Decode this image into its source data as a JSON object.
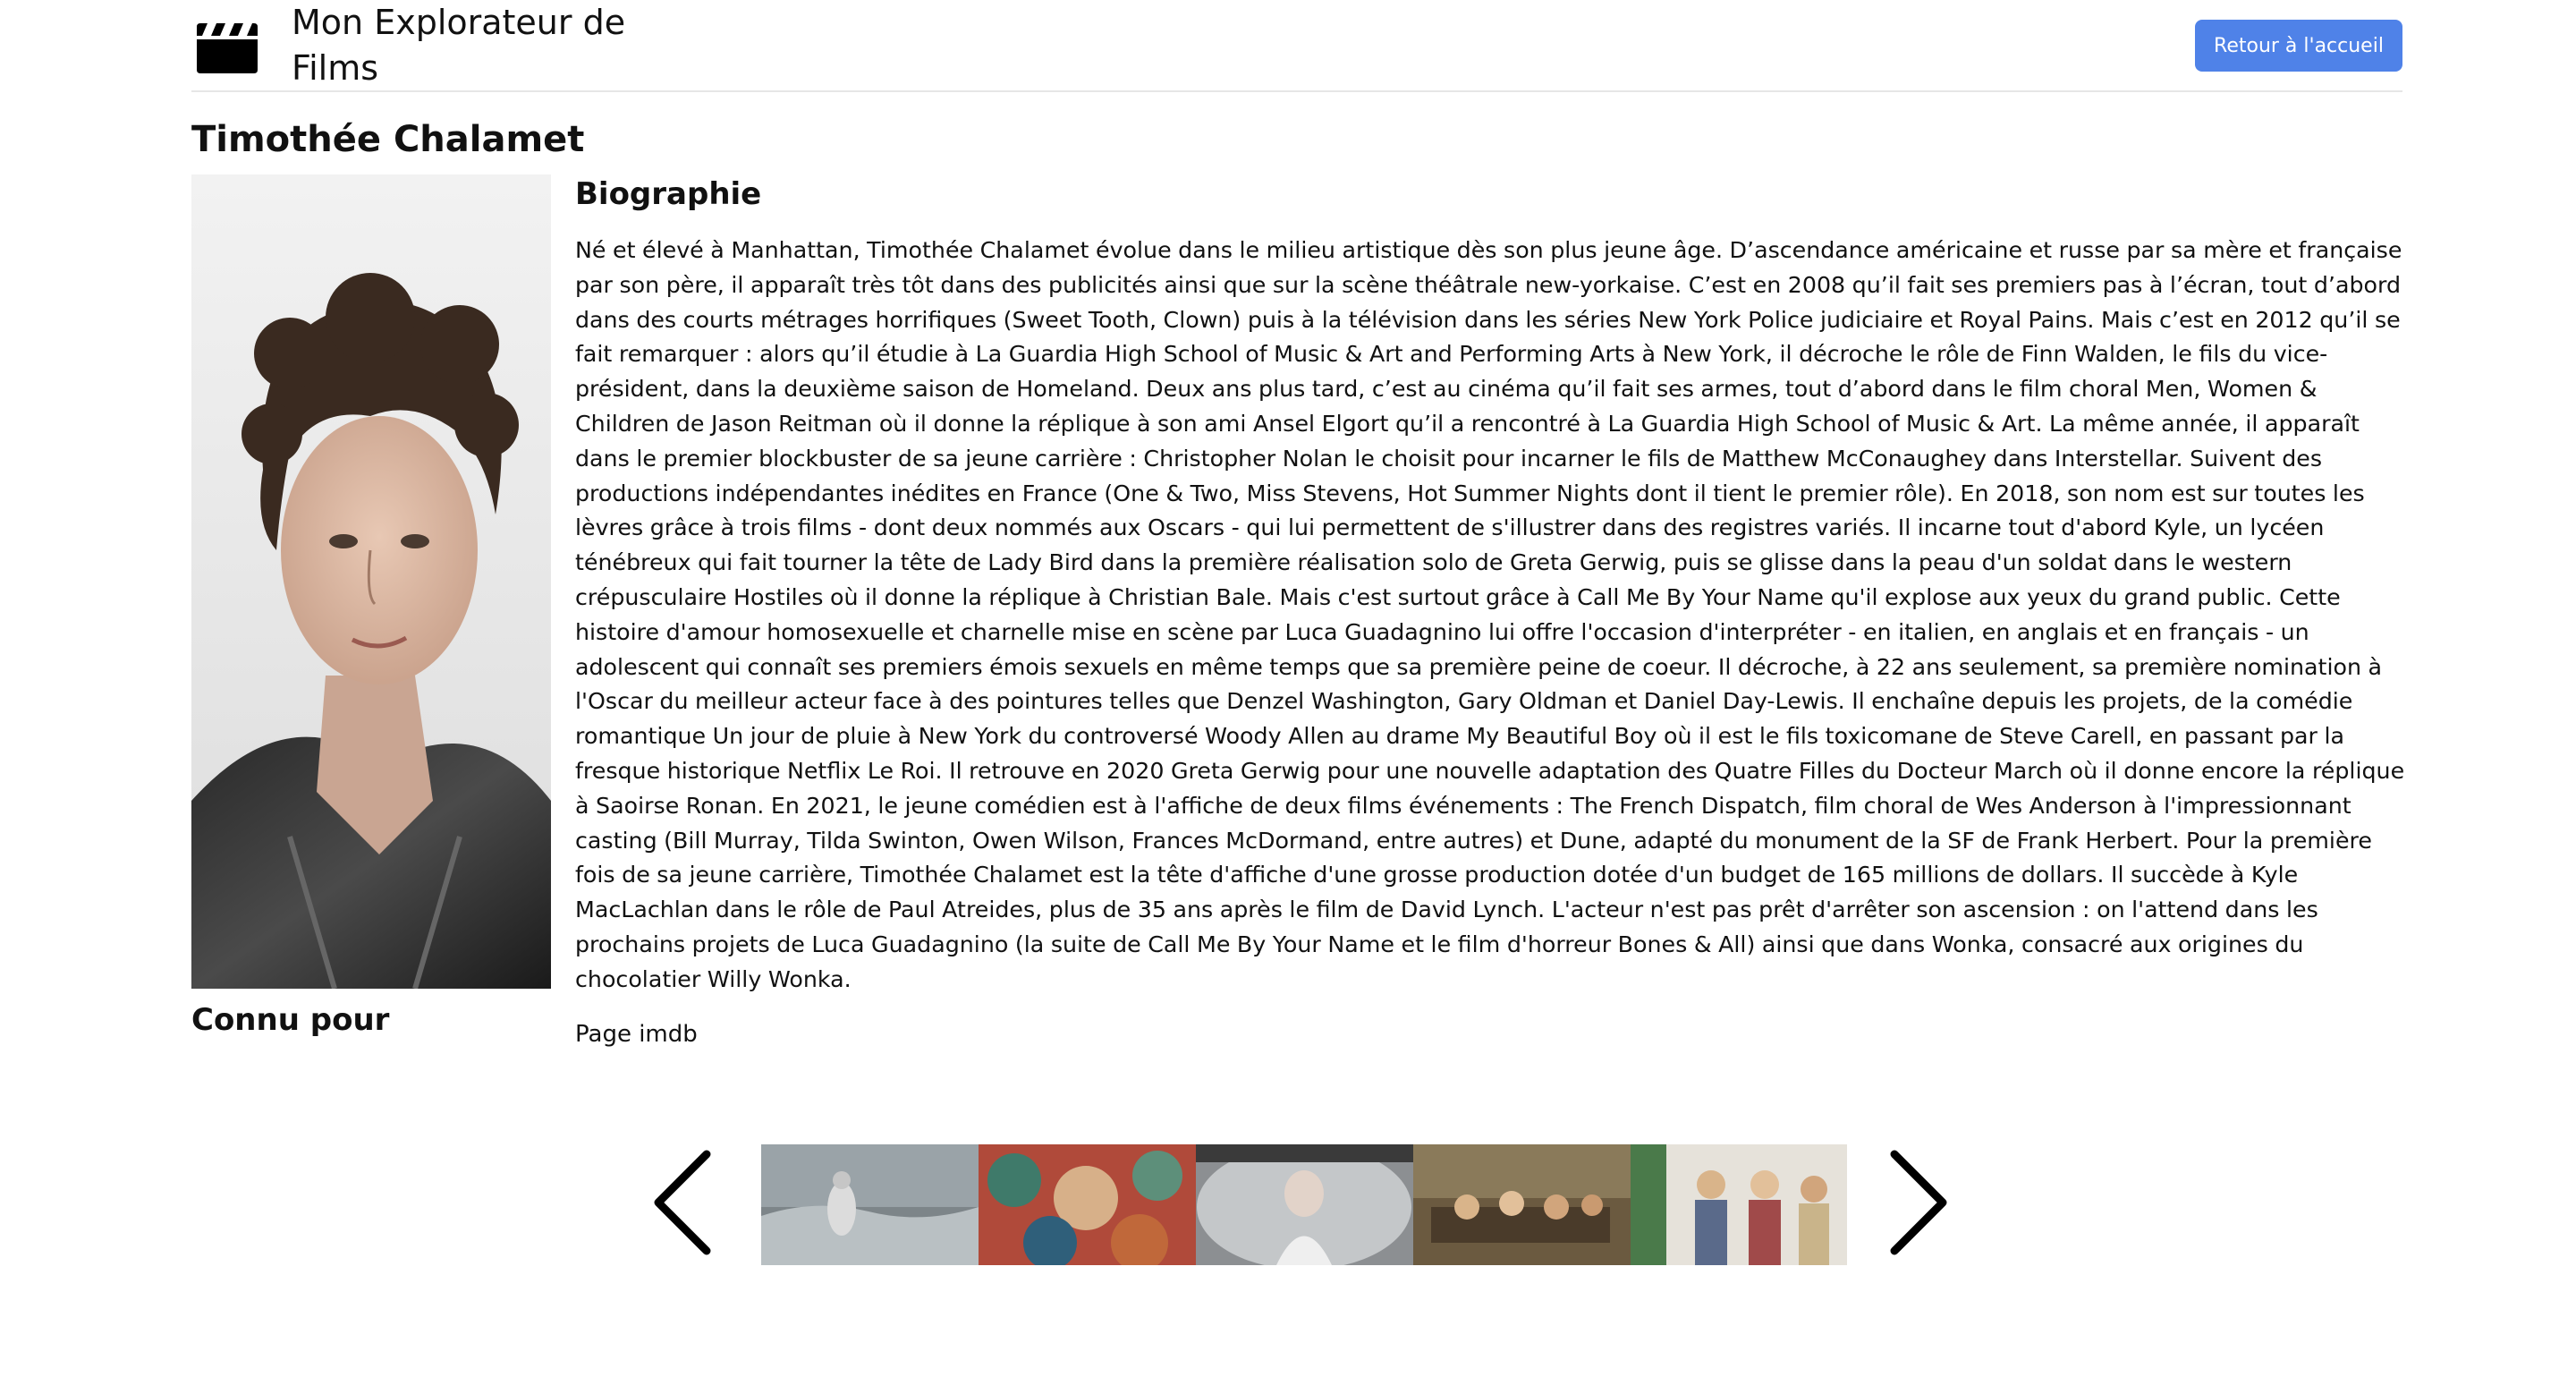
{
  "header": {
    "app_title": "Mon Explorateur de Films",
    "home_button_label": "Retour à l'accueil",
    "logo_icon": "clapperboard-icon"
  },
  "actor": {
    "name": "Timothée Chalamet",
    "bio_heading": "Biographie",
    "bio_text": "Né et élevé à Manhattan, Timothée Chalamet évolue dans le milieu artistique dès son plus jeune âge. D’ascendance américaine et russe par sa mère et française par son père, il apparaît très tôt dans des publicités ainsi que sur la scène théâtrale new-yorkaise. C’est en 2008 qu’il fait ses premiers pas à l’écran, tout d’abord dans des courts métrages horrifiques (Sweet Tooth, Clown) puis à la télévision dans les séries New York Police judiciaire et Royal Pains. Mais c’est en 2012 qu’il se fait remarquer : alors qu’il étudie à La Guardia High School of Music & Art and Performing Arts à New York, il décroche le rôle de Finn Walden, le fils du vice-président, dans la deuxième saison de Homeland. Deux ans plus tard, c’est au cinéma qu’il fait ses armes, tout d’abord dans le film choral Men, Women & Children de Jason Reitman où il donne la réplique à son ami Ansel Elgort qu’il a rencontré à La Guardia High School of Music & Art. La même année, il apparaît dans le premier blockbuster de sa jeune carrière : Christopher Nolan le choisit pour incarner le fils de Matthew McConaughey dans Interstellar. Suivent des productions indépendantes inédites en France (One & Two, Miss Stevens, Hot Summer Nights dont il tient le premier rôle). En 2018, son nom est sur toutes les lèvres grâce à trois films - dont deux nommés aux Oscars - qui lui permettent de s'illustrer dans des registres variés. Il incarne tout d'abord Kyle, un lycéen ténébreux qui fait tourner la tête de Lady Bird dans la première réalisation solo de Greta Gerwig, puis se glisse dans la peau d'un soldat dans le western crépusculaire Hostiles où il donne la réplique à Christian Bale. Mais c'est surtout grâce à Call Me By Your Name qu'il explose aux yeux du grand public. Cette histoire d'amour homosexuelle et charnelle mise en scène par Luca Guadagnino lui offre l'occasion d'interpréter - en italien, en anglais et en français - un adolescent qui connaît ses premiers émois sexuels en même temps que sa première peine de coeur. Il décroche, à 22 ans seulement, sa première nomination à l'Oscar du meilleur acteur face à des pointures telles que Denzel Washington, Gary Oldman et Daniel Day-Lewis. Il enchaîne depuis les projets, de la comédie romantique Un jour de pluie à New York du controversé Woody Allen au drame My Beautiful Boy où il est le fils toxicomane de Steve Carell, en passant par la fresque historique Netflix Le Roi. Il retrouve en 2020 Greta Gerwig pour une nouvelle adaptation des Quatre Filles du Docteur March où il donne encore la réplique à Saoirse Ronan. En 2021, le jeune comédien est à l'affiche de deux films événements : The French Dispatch, film choral de Wes Anderson à l'impressionnant casting (Bill Murray, Tilda Swinton, Owen Wilson, Frances McDormand, entre autres) et Dune, adapté du monument de la SF de Frank Herbert. Pour la première fois de sa jeune carrière, Timothée Chalamet est la tête d'affiche d'une grosse production dotée d'un budget de 165 millions de dollars. Il succède à Kyle MacLachlan dans le rôle de Paul Atreides, plus de 35 ans après le film de David Lynch. L'acteur n'est pas prêt d'arrêter son ascension : on l'attend dans les prochains projets de Luca Guadagnino (la suite de Call Me By Your Name et le film d'horreur Bones & All) ainsi que dans Wonka, consacré aux origines du chocolatier Willy Wonka.",
    "imdb_link_label": "Page imdb"
  },
  "known_for": {
    "heading": "Connu pour",
    "prev_icon": "chevron-left-icon",
    "next_icon": "chevron-right-icon",
    "posters": [
      {
        "id": "poster-1"
      },
      {
        "id": "poster-2"
      },
      {
        "id": "poster-3"
      },
      {
        "id": "poster-4"
      },
      {
        "id": "poster-5"
      }
    ]
  },
  "colors": {
    "accent": "#4f82e8",
    "text": "#111111",
    "divider": "#e6e6e6"
  }
}
